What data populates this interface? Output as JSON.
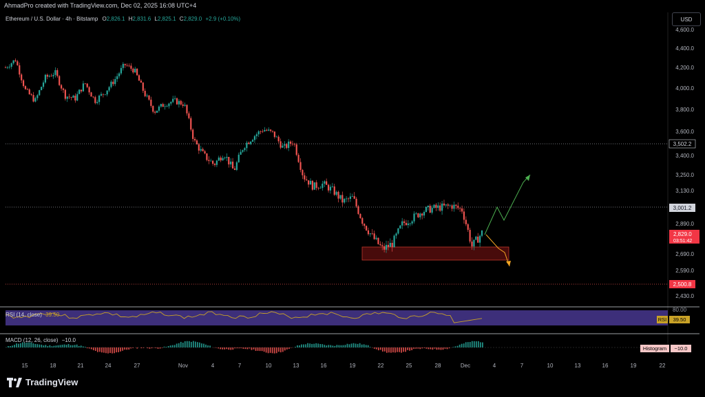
{
  "header": {
    "credit": "AhmadPro created with TradingView.com, Dec 02, 2025 16:08 UTC+4"
  },
  "legend": {
    "symbol": "Ethereum / U.S. Dollar · 4h · Bitstamp",
    "open_label": "O",
    "open": "2,826.1",
    "high_label": "H",
    "high": "2,831.6",
    "low_label": "L",
    "low": "2,825.1",
    "close_label": "C",
    "close": "2,829.0",
    "change": "+2.9 (+0.10%)"
  },
  "currency_button": "USD",
  "price_axis": {
    "labels": [
      "4,600.0",
      "4,400.0",
      "4,200.0",
      "4,000.0",
      "3,800.0",
      "3,600.0",
      "3,400.0",
      "3,250.0",
      "3,130.0",
      "2,890.0",
      "2,690.0",
      "2,590.0",
      "2,430.0"
    ],
    "level_tags": [
      "3,502.2",
      "3,001.2",
      "2,500.8"
    ],
    "current_price": "2,829.0",
    "countdown": "03:51:42"
  },
  "time_axis": {
    "labels": [
      "15",
      "18",
      "21",
      "24",
      "27",
      "Nov",
      "4",
      "7",
      "10",
      "13",
      "16",
      "19",
      "22",
      "25",
      "28",
      "Dec",
      "4",
      "7",
      "10",
      "13",
      "16",
      "19",
      "22"
    ]
  },
  "rsi": {
    "title": "RSI (14, close)",
    "value": "39.50",
    "top_level": "80.00",
    "tag_name": "RSI",
    "tag_value": "39.50"
  },
  "macd": {
    "title": "MACD (12, 26, close)",
    "value": "−10.0",
    "tag_name": "Histogram",
    "tag_value": "−10.0"
  },
  "footer": {
    "brand": "TradingView"
  },
  "colors": {
    "up": "#26a69a",
    "down": "#ef5350",
    "rsi_line": "#c9a227",
    "rsi_band": "#4a3a8a",
    "green_path": "#4caf50",
    "orange_path": "#f5a623",
    "zone": "#6b1010"
  },
  "chart_data": {
    "type": "candlestick",
    "title": "Ethereum / U.S. Dollar · 4h · Bitstamp",
    "close_path": [
      [
        "15",
        4200
      ],
      [
        "16",
        4280
      ],
      [
        "17",
        3980
      ],
      [
        "18",
        3880
      ],
      [
        "19",
        4100
      ],
      [
        "20",
        4150
      ],
      [
        "21",
        3930
      ],
      [
        "22",
        3900
      ],
      [
        "23",
        4050
      ],
      [
        "24",
        3880
      ],
      [
        "25",
        3960
      ],
      [
        "26",
        4080
      ],
      [
        "27",
        4230
      ],
      [
        "28",
        4170
      ],
      [
        "29",
        3950
      ],
      [
        "30",
        3780
      ],
      [
        "31",
        3850
      ],
      [
        "Nov 1",
        3880
      ],
      [
        "2",
        3850
      ],
      [
        "3",
        3520
      ],
      [
        "4",
        3400
      ],
      [
        "5",
        3330
      ],
      [
        "6",
        3420
      ],
      [
        "7",
        3280
      ],
      [
        "8",
        3480
      ],
      [
        "9",
        3560
      ],
      [
        "10",
        3620
      ],
      [
        "11",
        3580
      ],
      [
        "12",
        3460
      ],
      [
        "13",
        3520
      ],
      [
        "14",
        3240
      ],
      [
        "15",
        3160
      ],
      [
        "16",
        3180
      ],
      [
        "17",
        3130
      ],
      [
        "18",
        3050
      ],
      [
        "19",
        3080
      ],
      [
        "20",
        2900
      ],
      [
        "21",
        2800
      ],
      [
        "22",
        2720
      ],
      [
        "23",
        2760
      ],
      [
        "24",
        2890
      ],
      [
        "25",
        2930
      ],
      [
        "26",
        2980
      ],
      [
        "27",
        3000
      ],
      [
        "28",
        3010
      ],
      [
        "29",
        3020
      ],
      [
        "30",
        2990
      ],
      [
        "Dec 1",
        2740
      ],
      [
        "Dec 2",
        2829
      ]
    ],
    "price_lines": [
      3502.2,
      3001.2,
      2500.8
    ],
    "support_zone": [
      2640,
      2760
    ],
    "projections": [
      "green: up toward 3,250",
      "orange: down toward 2,600"
    ],
    "ylim": [
      2400,
      4650
    ]
  }
}
